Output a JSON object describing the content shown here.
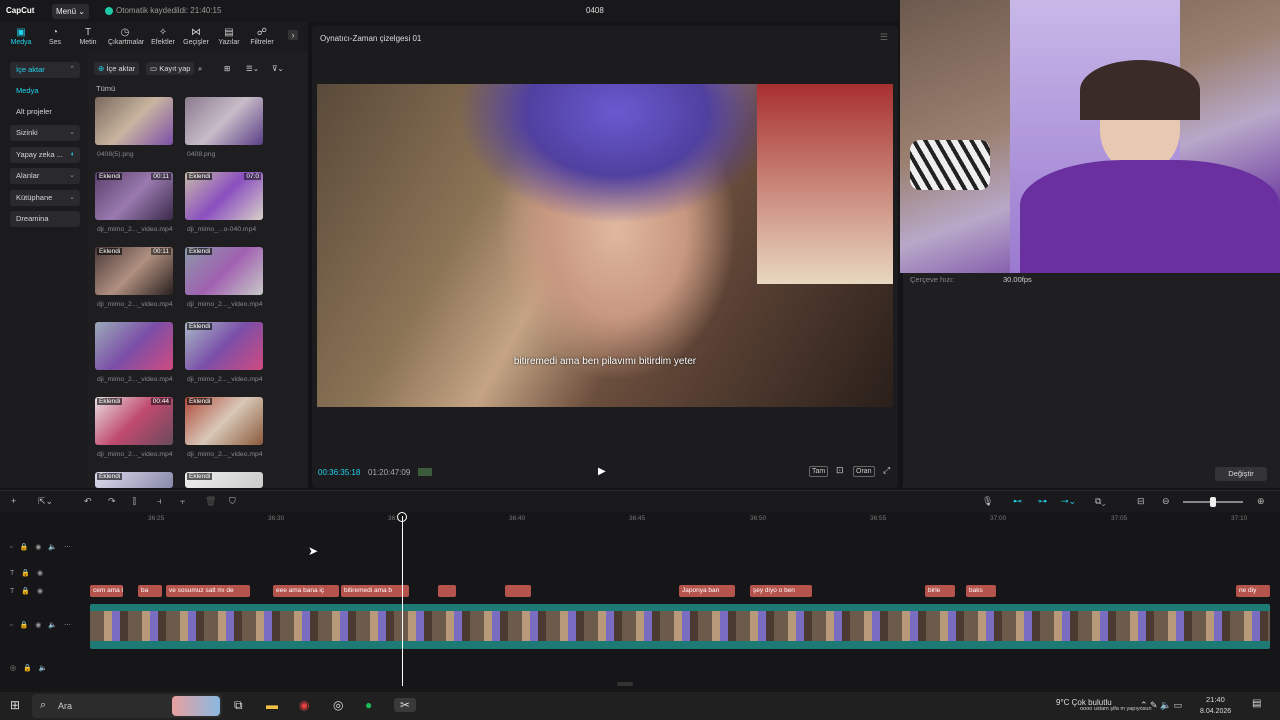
{
  "app": {
    "logo": "CapCut",
    "menu_label": "Menü",
    "autosave": "Otomatik kaydedildi: 21:40:15",
    "project_title": "0408"
  },
  "tooltabs": [
    {
      "label": "Medya",
      "icon": "media-icon"
    },
    {
      "label": "Ses",
      "icon": "audio-icon"
    },
    {
      "label": "Metin",
      "icon": "text-icon"
    },
    {
      "label": "Çıkartmalar",
      "icon": "sticker-icon"
    },
    {
      "label": "Efektler",
      "icon": "effects-icon"
    },
    {
      "label": "Geçişler",
      "icon": "transitions-icon"
    },
    {
      "label": "Yazılar",
      "icon": "captions-icon"
    },
    {
      "label": "Filtreler",
      "icon": "filters-icon"
    }
  ],
  "leftnav": [
    {
      "label": "İçe aktar"
    },
    {
      "label": "Medya"
    },
    {
      "label": "Alt projeler"
    },
    {
      "label": "Sizinki"
    },
    {
      "label": "Yapay zeka ..."
    },
    {
      "label": "Alanlar"
    },
    {
      "label": "Kütüphane"
    },
    {
      "label": "Dreamina"
    }
  ],
  "media": {
    "import_label": "İçe aktar",
    "record_label": "Kayıt yap",
    "all_label": "Tümü",
    "items": [
      {
        "name": "0408(5).png",
        "badge": "",
        "duration": ""
      },
      {
        "name": "0408.png",
        "badge": "",
        "duration": ""
      },
      {
        "name": "dji_mimo_2..._video.mp4",
        "badge": "Eklendi",
        "duration": "00:11"
      },
      {
        "name": "dji_mimo_...o-040.mp4",
        "badge": "Eklendi",
        "duration": "07:0"
      },
      {
        "name": "dji_mimo_2..._video.mp4",
        "badge": "Eklendi",
        "duration": "00:11"
      },
      {
        "name": "dji_mimo_2..._video.mp4",
        "badge": "Eklendi",
        "duration": ""
      },
      {
        "name": "dji_mimo_2..._video.mp4",
        "badge": "",
        "duration": ""
      },
      {
        "name": "dji_mimo_2..._video.mp4",
        "badge": "Eklendi",
        "duration": ""
      },
      {
        "name": "dji_mimo_2..._video.mp4",
        "badge": "Eklendi",
        "duration": "00:44"
      },
      {
        "name": "dji_mimo_2..._video.mp4",
        "badge": "Eklendi",
        "duration": ""
      },
      {
        "name": "",
        "badge": "Eklendi",
        "duration": ""
      },
      {
        "name": "",
        "badge": "Eklendi",
        "duration": ""
      }
    ]
  },
  "player": {
    "title": "Oynatıcı-Zaman çizelgesi 01",
    "subtitle": "bitiremedi ama ben pilavımı bitirdim yeter",
    "current_time": "00:36:35:18",
    "total_time": "01:20:47:09",
    "btn_full": "Tam",
    "btn_ratio": "Oran"
  },
  "properties": {
    "frame_rate_label": "Çerçeve hızı:",
    "frame_rate_value": "30.00fps",
    "change_label": "Değiştir"
  },
  "timeline": {
    "ruler": [
      "36:25",
      "36:30",
      "36:35",
      "36:40",
      "36:45",
      "36:50",
      "36:55",
      "37:00",
      "37:05",
      "37:10"
    ],
    "captions": [
      "cem ama i",
      "ba",
      "ve sosumuz salt mı de",
      "eee ama bana iç",
      "bitiremedi ama b",
      "",
      "",
      "Japonya ban",
      "şey diyo o ben",
      "birle",
      "baks",
      "ne diy"
    ]
  },
  "taskbar": {
    "search_placeholder": "Ara",
    "weather": "9°C Çok bulutlu",
    "ticker": "oooo ustam şifa m yapıyosun",
    "time": "21:40",
    "date": "8.04.2026"
  }
}
